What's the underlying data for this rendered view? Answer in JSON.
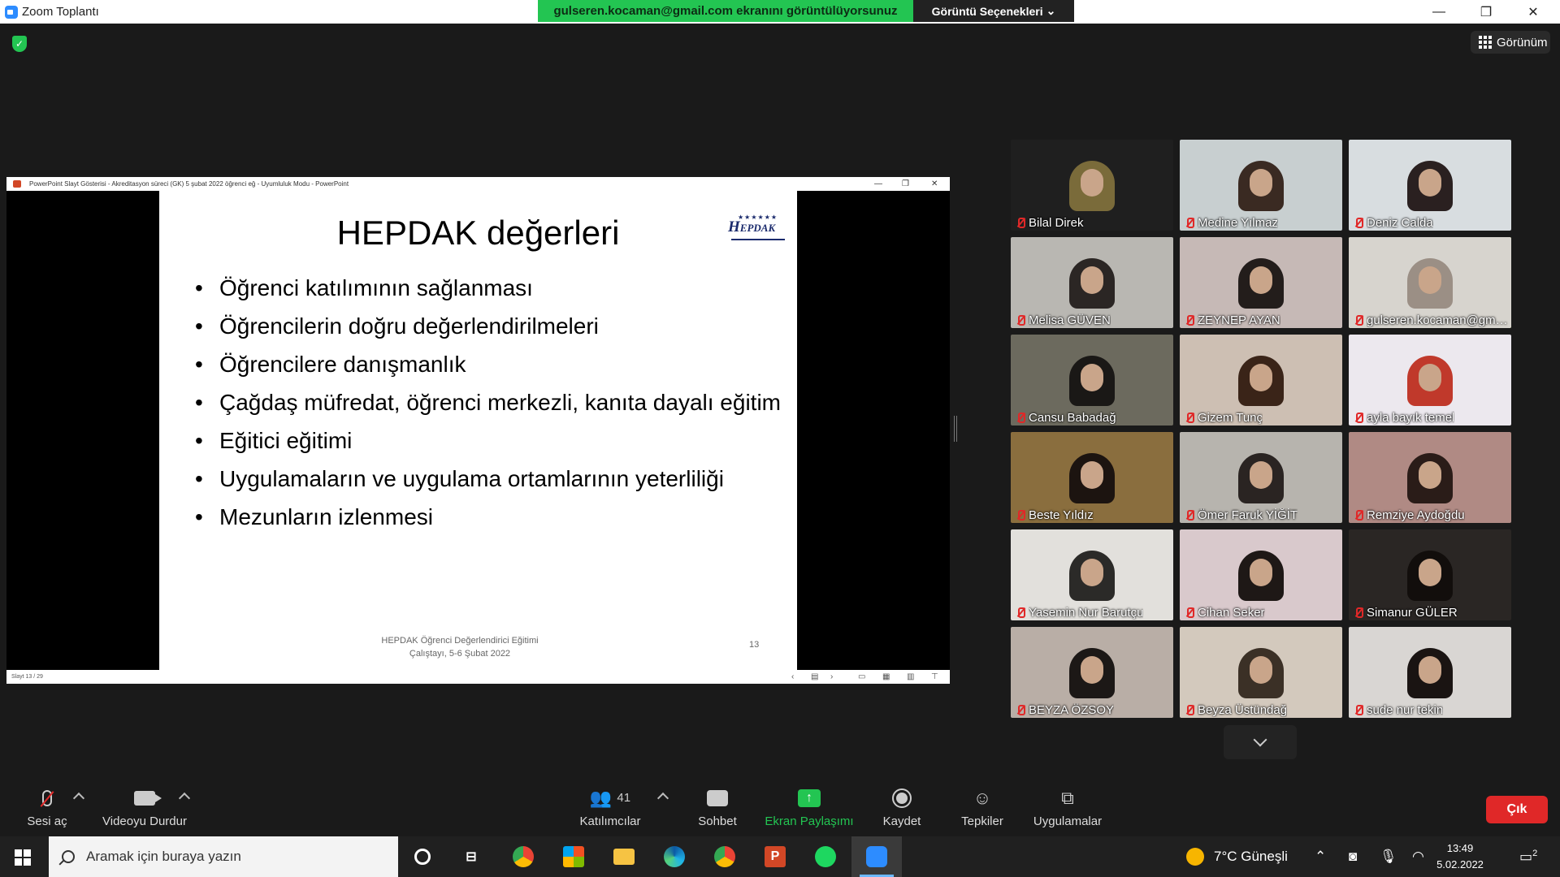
{
  "window": {
    "title": "Zoom Toplantı",
    "share_banner": "gulseren.kocaman@gmail.com  ekranını görüntülüyorsunuz",
    "view_options": "Görüntü Seçenekleri",
    "minimize": "—",
    "maximize": "❐",
    "close": "✕"
  },
  "view_button": "Görünüm",
  "ppt": {
    "titlebar": "PowerPoint Slayt Gösterisi  -  Akreditasyon süreci (GK) 5 şubat 2022 öğrenci eğ  -  Uyumluluk Modu - PowerPoint",
    "status": "Slayt 13 / 29"
  },
  "slide": {
    "title": "HEPDAK değerleri",
    "logo_text": "HEPDAK",
    "bullets": [
      "Öğrenci katılımının sağlanması",
      "Öğrencilerin doğru değerlendirilmeleri",
      "Öğrencilere danışmanlık",
      "Çağdaş müfredat, öğrenci merkezli, kanıta dayalı eğitim",
      "Eğitici eğitimi",
      "Uygulamaların ve uygulama ortamlarının yeterliliği",
      "Mezunların izlenmesi"
    ],
    "footer_line1": "HEPDAK Öğrenci Değerlendirici Eğitimi",
    "footer_line2": "Çalıştayı, 5-6 Şubat 2022",
    "number": "13"
  },
  "participants": [
    {
      "name": "Bilal Direk",
      "bg": "#1f1f1f",
      "accent": "#7a6b3a"
    },
    {
      "name": "Medine Yılmaz",
      "bg": "#c8cfd0",
      "accent": "#3a2a22"
    },
    {
      "name": "Deniz Calda",
      "bg": "#d8dde0",
      "accent": "#2a2020"
    },
    {
      "name": "Melisa GÜVEN",
      "bg": "#b9b7b2",
      "accent": "#2b2624"
    },
    {
      "name": "ZEYNEP AYAN",
      "bg": "#c6b9b6",
      "accent": "#231d1b"
    },
    {
      "name": "gulseren.kocaman@gmail...",
      "bg": "#d7d4ce",
      "accent": "#9b8f85"
    },
    {
      "name": "Cansu Babadağ",
      "bg": "#6c6a5e",
      "accent": "#1a1816"
    },
    {
      "name": "Gizem Tunç",
      "bg": "#cdbfb3",
      "accent": "#3a2418"
    },
    {
      "name": "ayla bayık temel",
      "bg": "#ece8ee",
      "accent": "#c0392b"
    },
    {
      "name": "Beste Yıldız",
      "bg": "#8a6e3e",
      "accent": "#1c1410"
    },
    {
      "name": "Ömer Faruk YİĞİT",
      "bg": "#b7b4ae",
      "accent": "#2a2422"
    },
    {
      "name": "Remziye Aydoğdu",
      "bg": "#b08a84",
      "accent": "#2a1c18"
    },
    {
      "name": "Yasemin Nur Barutçu",
      "bg": "#e2e0dc",
      "accent": "#2b2a28"
    },
    {
      "name": "Cihan Seker",
      "bg": "#d9c9cc",
      "accent": "#1e1816"
    },
    {
      "name": "Simanur GÜLER",
      "bg": "#2a2624",
      "accent": "#120e0c"
    },
    {
      "name": "BEYZA ÖZSOY",
      "bg": "#b9aea6",
      "accent": "#1c1816"
    },
    {
      "name": "Beyza Üstündağ",
      "bg": "#d3c9bd",
      "accent": "#3b3026"
    },
    {
      "name": "sude nur tekin",
      "bg": "#d9d6d3",
      "accent": "#1a1412"
    }
  ],
  "toolbar": {
    "mute": "Sesi aç",
    "video": "Videoyu Durdur",
    "participants": "Katılımcılar",
    "participants_count": "41",
    "chat": "Sohbet",
    "share": "Ekran Paylaşımı",
    "record": "Kaydet",
    "reactions": "Tepkiler",
    "apps": "Uygulamalar",
    "leave": "Çık"
  },
  "taskbar": {
    "search_placeholder": "Aramak için buraya yazın",
    "weather": "7°C  Güneşli",
    "time": "13:49",
    "date": "5.02.2022",
    "notifications": "2"
  }
}
